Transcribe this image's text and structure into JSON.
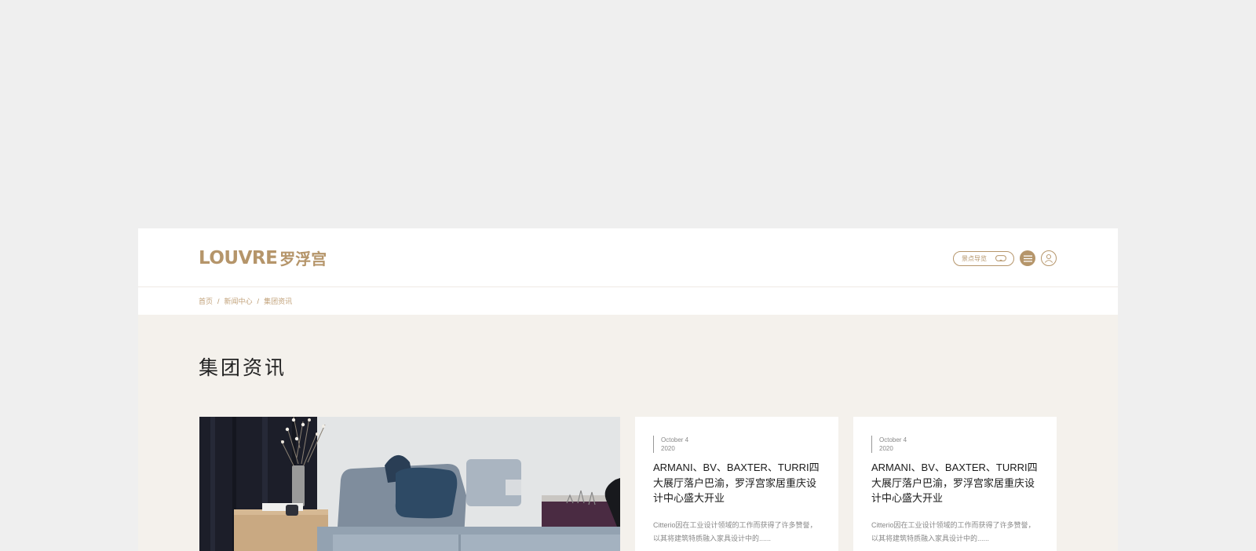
{
  "brand": {
    "latin": "LOUVRE",
    "cn": "罗浮宫",
    "color": "#b5956a"
  },
  "header": {
    "guide_label": "景点导览",
    "guide_icon": "vr-headset-icon",
    "menu_icon": "hamburger-menu-icon",
    "user_icon": "user-icon"
  },
  "breadcrumb": {
    "items": [
      "首页",
      "新闻中心",
      "集团资讯"
    ],
    "separator": "/"
  },
  "page": {
    "title": "集团资讯"
  },
  "articles": [
    {
      "date_month_day": "October 4",
      "date_year": "2020",
      "title": "ARMANI、BV、BAXTER、TURRI四大展厅落户巴渝，罗浮宫家居重庆设计中心盛大开业",
      "excerpt": "Citterio因在工业设计领域的工作而获得了许多赞誉，以其将建筑特质融入家具设计中的......"
    },
    {
      "date_month_day": "October 4",
      "date_year": "2020",
      "title": "ARMANI、BV、BAXTER、TURRI四大展厅落户巴渝，罗浮宫家居重庆设计中心盛大开业",
      "excerpt": "Citterio因在工业设计领域的工作而获得了许多赞誉，以其将建筑特质融入家具设计中的......"
    }
  ]
}
